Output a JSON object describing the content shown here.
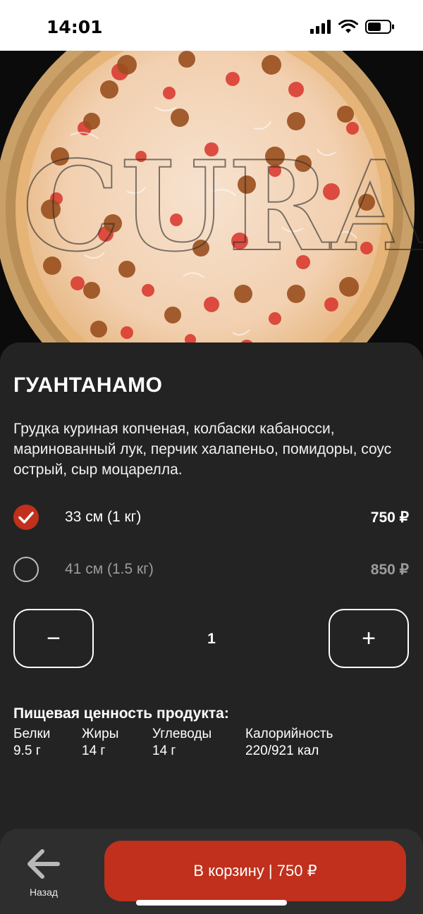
{
  "status": {
    "time": "14:01"
  },
  "hero": {
    "watermark": "CURA"
  },
  "product": {
    "title": "ГУАНТАНАМО",
    "description": "Грудка куриная копченая, колбаски кабаносси, маринованный лук, перчик халапеньо, помидоры, соус острый, сыр моцарелла."
  },
  "sizes": [
    {
      "label": "33 см (1 кг)",
      "price": "750 ₽",
      "selected": true
    },
    {
      "label": "41 см (1.5 кг)",
      "price": "850 ₽",
      "selected": false
    }
  ],
  "quantity": {
    "minus": "−",
    "value": "1",
    "plus": "+"
  },
  "nutrition": {
    "title": "Пищевая ценность продукта:",
    "items": [
      {
        "label": "Белки",
        "value": "9.5 г"
      },
      {
        "label": "Жиры",
        "value": "14 г"
      },
      {
        "label": "Углеводы",
        "value": "14 г"
      },
      {
        "label": "Калорийность",
        "value": "220/921 кал"
      }
    ]
  },
  "bottom": {
    "back_label": "Назад",
    "cart_label": "В корзину | 750 ₽"
  },
  "colors": {
    "accent": "#c0301c",
    "background": "#232323",
    "bar": "#2e2e2e"
  }
}
